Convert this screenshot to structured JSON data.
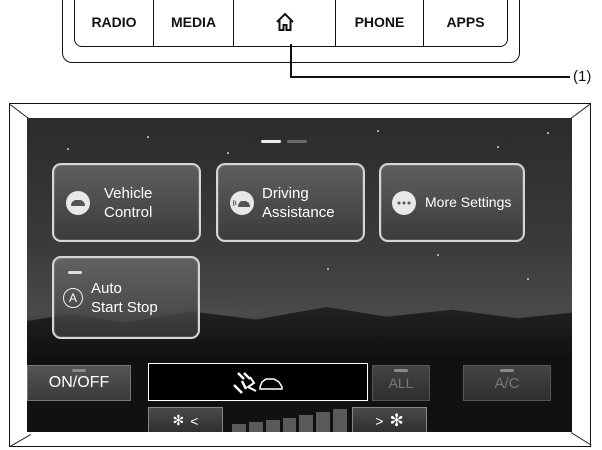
{
  "hard_buttons": {
    "radio": "RADIO",
    "media": "MEDIA",
    "home_icon": "home-icon",
    "phone": "PHONE",
    "apps": "APPS"
  },
  "callout": {
    "label": "(1)"
  },
  "screen": {
    "pager": {
      "pages": 2,
      "active_page": 1
    },
    "tiles": [
      {
        "label_line1": "Vehicle",
        "label_line2": "Control",
        "icon": "car-icon"
      },
      {
        "label_line1": "Driving",
        "label_line2": "Assistance",
        "icon": "driver-assist-icon"
      },
      {
        "label": "More Settings",
        "icon": "more-dots-icon"
      },
      {
        "label_line1": "Auto",
        "label_line2": "Start Stop",
        "icon": "auto-start-stop-icon"
      }
    ]
  },
  "climate": {
    "on_off": "ON/OFF",
    "airflow_icon": "airflow-mode-icon",
    "all_label": "ALL",
    "ac_label": "A/C",
    "fan_down_symbol": "<",
    "fan_up_symbol": ">",
    "fan_level_bars": 7
  }
}
